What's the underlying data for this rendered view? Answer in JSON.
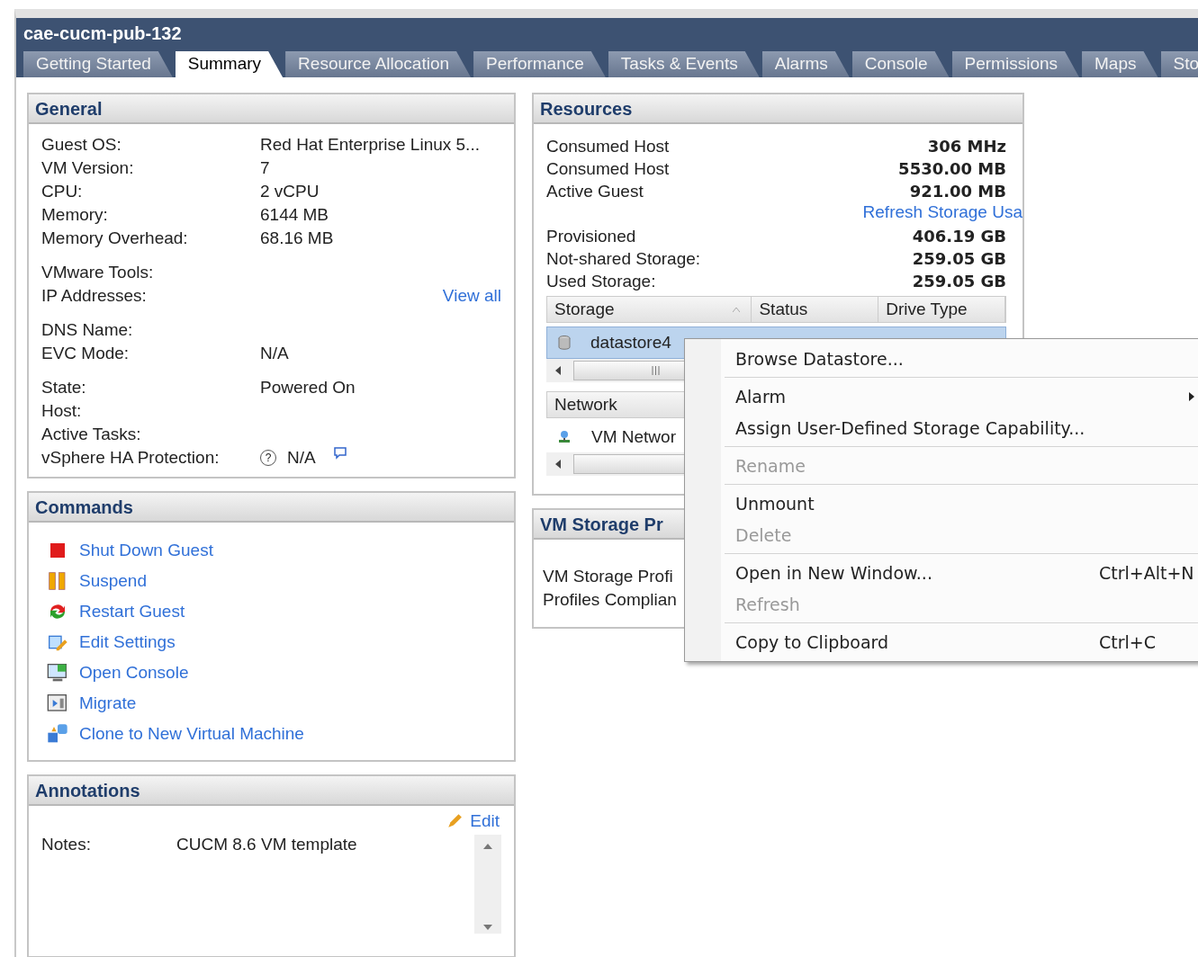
{
  "window": {
    "title": "cae-cucm-pub-132"
  },
  "tabs": [
    {
      "label": "Getting Started",
      "selected": false
    },
    {
      "label": "Summary",
      "selected": true
    },
    {
      "label": "Resource Allocation",
      "selected": false
    },
    {
      "label": "Performance",
      "selected": false
    },
    {
      "label": "Tasks & Events",
      "selected": false
    },
    {
      "label": "Alarms",
      "selected": false
    },
    {
      "label": "Console",
      "selected": false
    },
    {
      "label": "Permissions",
      "selected": false
    },
    {
      "label": "Maps",
      "selected": false
    },
    {
      "label": "Sto",
      "selected": false
    }
  ],
  "general": {
    "title": "General",
    "groups": [
      [
        {
          "label": "Guest OS:",
          "value": "Red Hat Enterprise Linux 5..."
        },
        {
          "label": "VM Version:",
          "value": "7"
        },
        {
          "label": "CPU:",
          "value": "2 vCPU"
        },
        {
          "label": "Memory:",
          "value": "6144 MB"
        },
        {
          "label": "Memory Overhead:",
          "value": "68.16 MB"
        }
      ],
      [
        {
          "label": "VMware Tools:"
        },
        {
          "label": "IP Addresses:",
          "link": "View all"
        }
      ],
      [
        {
          "label": "DNS Name:"
        },
        {
          "label": "EVC Mode:",
          "value": "N/A"
        }
      ],
      [
        {
          "label": "State:",
          "value": "Powered On"
        },
        {
          "label": "Host:"
        },
        {
          "label": "Active Tasks:"
        },
        {
          "label": "vSphere HA Protection:",
          "value": "N/A",
          "help": "?",
          "comment": true
        }
      ]
    ]
  },
  "commands": {
    "title": "Commands",
    "items": [
      {
        "label": "Shut Down Guest",
        "kind": "stop"
      },
      {
        "label": "Suspend",
        "kind": "pause"
      },
      {
        "label": "Restart Guest",
        "kind": "restart"
      },
      {
        "label": "Edit Settings",
        "kind": "edit"
      },
      {
        "label": "Open Console",
        "kind": "console"
      },
      {
        "label": "Migrate",
        "kind": "migrate"
      },
      {
        "label": "Clone to New Virtual Machine",
        "kind": "clone"
      }
    ]
  },
  "annotations": {
    "title": "Annotations",
    "edit": "Edit",
    "notes_label": "Notes:",
    "notes": "CUCM 8.6 VM template"
  },
  "resources": {
    "title": "Resources",
    "rows": [
      {
        "label": "Consumed Host",
        "value": "306 MHz"
      },
      {
        "label": "Consumed Host",
        "value": "5530.00 MB"
      },
      {
        "label": "Active Guest",
        "value": "921.00 MB"
      }
    ],
    "refresh_link": "Refresh Storage Usa",
    "storage_rows": [
      {
        "label": "Provisioned",
        "value": "406.19 GB"
      },
      {
        "label": "Not-shared Storage:",
        "value": "259.05 GB"
      },
      {
        "label": "Used Storage:",
        "value": "259.05 GB"
      }
    ],
    "storage_table": {
      "columns": [
        "Storage",
        "Status",
        "Drive Type"
      ],
      "rows": [
        {
          "name": "datastore4",
          "selected": true
        }
      ]
    },
    "network_table": {
      "columns": [
        "Network"
      ],
      "rows": [
        {
          "name": "VM Networ"
        }
      ]
    }
  },
  "storage_profiles": {
    "title": "VM Storage Pr",
    "rows": [
      "VM Storage Profi",
      "Profiles Complian"
    ]
  },
  "context_menu": {
    "items": [
      {
        "kind": "item",
        "label": "Browse Datastore...",
        "disabled": false
      },
      {
        "kind": "separator"
      },
      {
        "kind": "item",
        "label": "Alarm",
        "disabled": false,
        "submenu": true
      },
      {
        "kind": "item",
        "label": "Assign User-Defined Storage Capability...",
        "disabled": false
      },
      {
        "kind": "separator"
      },
      {
        "kind": "item",
        "label": "Rename",
        "disabled": true
      },
      {
        "kind": "separator"
      },
      {
        "kind": "item",
        "label": "Unmount",
        "disabled": false
      },
      {
        "kind": "item",
        "label": "Delete",
        "disabled": true
      },
      {
        "kind": "separator"
      },
      {
        "kind": "item",
        "label": "Open in New Window...",
        "disabled": false,
        "shortcut": "Ctrl+Alt+N"
      },
      {
        "kind": "item",
        "label": "Refresh",
        "disabled": true
      },
      {
        "kind": "separator"
      },
      {
        "kind": "item",
        "label": "Copy to Clipboard",
        "disabled": false,
        "shortcut": "Ctrl+C"
      }
    ]
  }
}
